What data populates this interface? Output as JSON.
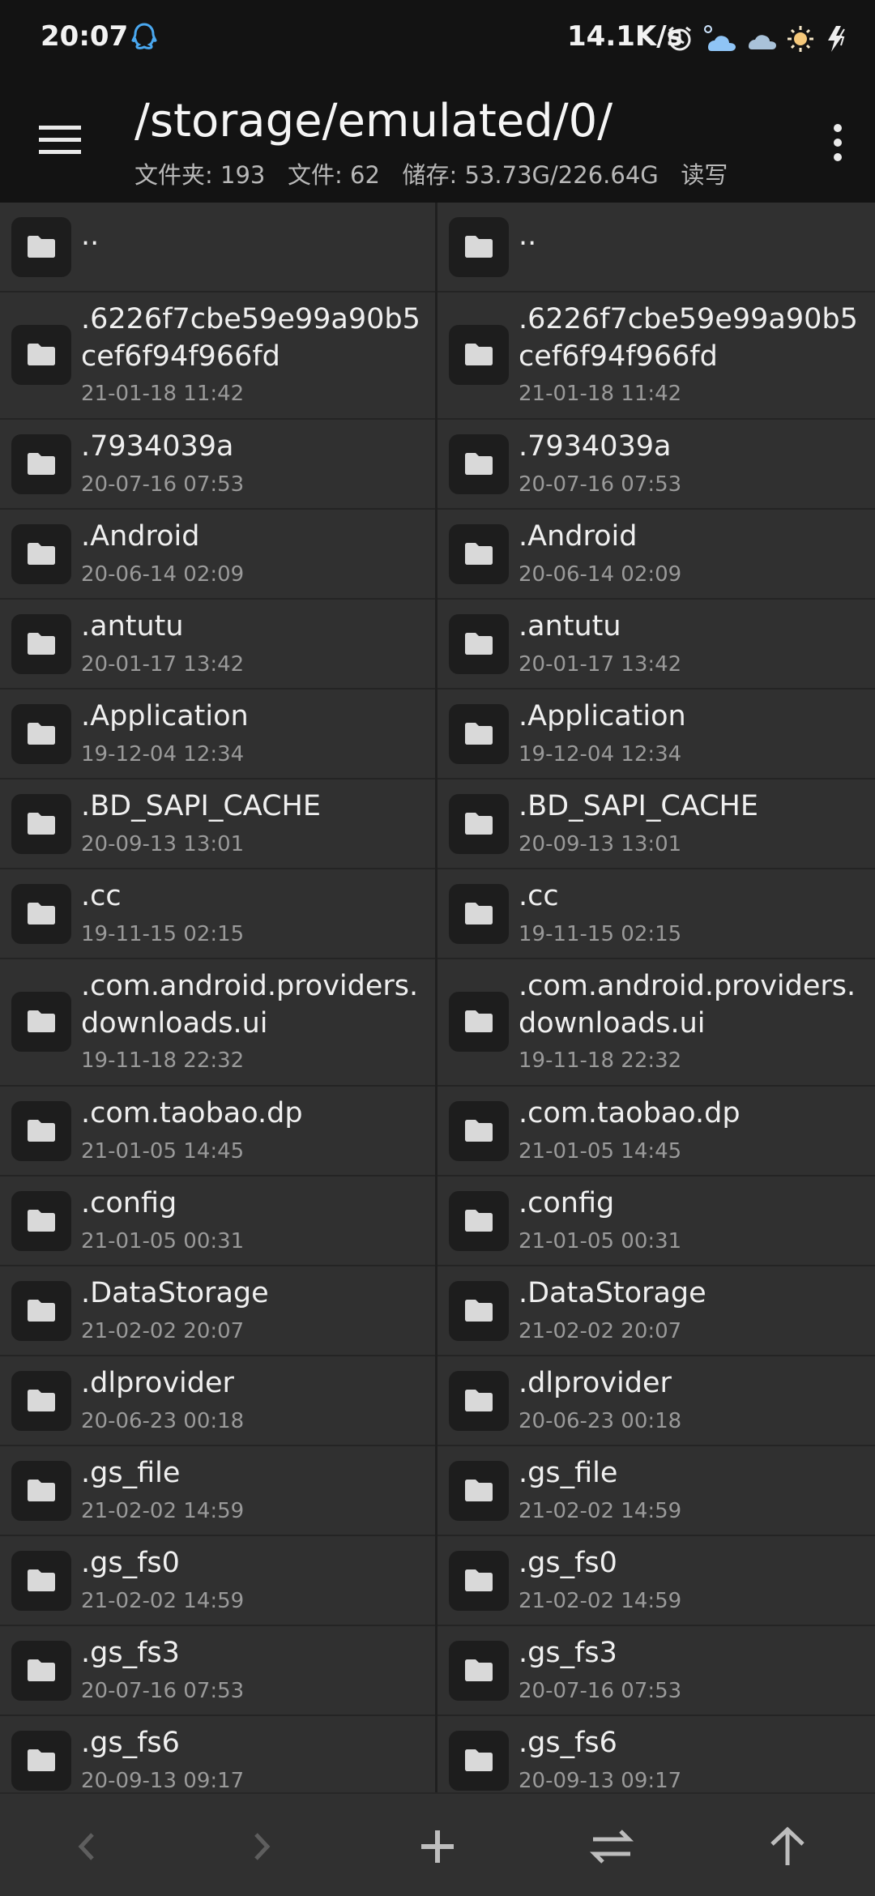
{
  "status_bar": {
    "time": "20:07",
    "net_speed": "14.1K/s",
    "icons": [
      "qq-icon",
      "alarm-icon",
      "weather-cloud-sun-icon",
      "cloud-icon",
      "sun-icon",
      "charging-icon"
    ]
  },
  "header": {
    "path": "/storage/emulated/0/",
    "folders_label": "文件夹: 193",
    "files_label": "文件: 62",
    "storage_label": "储存: 53.73G/226.64G",
    "mode_label": "读写"
  },
  "left_pane": {
    "items": [
      {
        "name": "..",
        "date": ""
      },
      {
        "name": ".6226f7cbe59e99a90b5cef6f94f966fd",
        "date": "21-01-18 11:42"
      },
      {
        "name": ".7934039a",
        "date": "20-07-16 07:53"
      },
      {
        "name": ".Android",
        "date": "20-06-14 02:09"
      },
      {
        "name": ".antutu",
        "date": "20-01-17 13:42"
      },
      {
        "name": ".Application",
        "date": "19-12-04 12:34"
      },
      {
        "name": ".BD_SAPI_CACHE",
        "date": "20-09-13 13:01"
      },
      {
        "name": ".cc",
        "date": "19-11-15 02:15"
      },
      {
        "name": ".com.android.providers.downloads.ui",
        "date": "19-11-18 22:32"
      },
      {
        "name": ".com.taobao.dp",
        "date": "21-01-05 14:45"
      },
      {
        "name": ".config",
        "date": "21-01-05 00:31"
      },
      {
        "name": ".DataStorage",
        "date": "21-02-02 20:07"
      },
      {
        "name": ".dlprovider",
        "date": "20-06-23 00:18"
      },
      {
        "name": ".gs_file",
        "date": "21-02-02 14:59"
      },
      {
        "name": ".gs_fs0",
        "date": "21-02-02 14:59"
      },
      {
        "name": ".gs_fs3",
        "date": "20-07-16 07:53"
      },
      {
        "name": ".gs_fs6",
        "date": "20-09-13 09:17"
      }
    ]
  },
  "right_pane": {
    "items": [
      {
        "name": "..",
        "date": ""
      },
      {
        "name": ".6226f7cbe59e99a90b5cef6f94f966fd",
        "date": "21-01-18 11:42"
      },
      {
        "name": ".7934039a",
        "date": "20-07-16 07:53"
      },
      {
        "name": ".Android",
        "date": "20-06-14 02:09"
      },
      {
        "name": ".antutu",
        "date": "20-01-17 13:42"
      },
      {
        "name": ".Application",
        "date": "19-12-04 12:34"
      },
      {
        "name": ".BD_SAPI_CACHE",
        "date": "20-09-13 13:01"
      },
      {
        "name": ".cc",
        "date": "19-11-15 02:15"
      },
      {
        "name": ".com.android.providers.downloads.ui",
        "date": "19-11-18 22:32"
      },
      {
        "name": ".com.taobao.dp",
        "date": "21-01-05 14:45"
      },
      {
        "name": ".config",
        "date": "21-01-05 00:31"
      },
      {
        "name": ".DataStorage",
        "date": "21-02-02 20:07"
      },
      {
        "name": ".dlprovider",
        "date": "20-06-23 00:18"
      },
      {
        "name": ".gs_file",
        "date": "21-02-02 14:59"
      },
      {
        "name": ".gs_fs0",
        "date": "21-02-02 14:59"
      },
      {
        "name": ".gs_fs3",
        "date": "20-07-16 07:53"
      },
      {
        "name": ".gs_fs6",
        "date": "20-09-13 09:17"
      }
    ]
  },
  "bottom_bar": {
    "buttons": [
      "back-icon",
      "forward-icon",
      "add-icon",
      "swap-icon",
      "up-icon"
    ]
  },
  "colors": {
    "accent_progress": "#3ec414",
    "bar_background": "#131313",
    "pane_background": "#303030"
  }
}
